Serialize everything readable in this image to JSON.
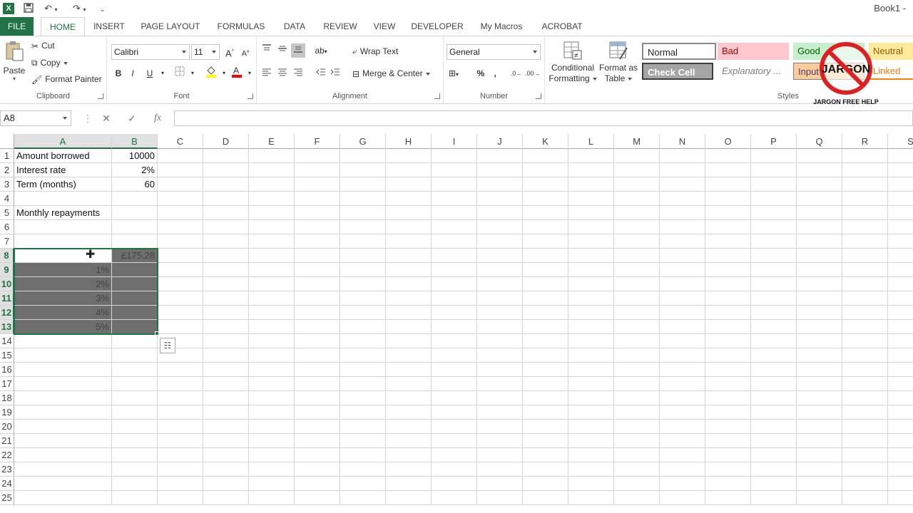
{
  "window": {
    "title": "Book1 -"
  },
  "tabs": [
    "FILE",
    "HOME",
    "INSERT",
    "PAGE LAYOUT",
    "FORMULAS",
    "DATA",
    "REVIEW",
    "VIEW",
    "DEVELOPER",
    "My Macros",
    "ACROBAT"
  ],
  "clipboard": {
    "paste": "Paste",
    "cut": "Cut",
    "copy": "Copy",
    "format_painter": "Format Painter",
    "label": "Clipboard"
  },
  "font": {
    "name": "Calibri",
    "size": "11",
    "label": "Font",
    "bold": "B",
    "italic": "I",
    "underline": "U",
    "grow": "A",
    "shrink": "A"
  },
  "alignment": {
    "wrap_text": "Wrap Text",
    "merge_center": "Merge & Center",
    "label": "Alignment"
  },
  "number": {
    "format": "General",
    "label": "Number",
    "percent": "%",
    "comma": ","
  },
  "styles": {
    "conditional_formatting": [
      "Conditional",
      "Formatting"
    ],
    "format_as_table": [
      "Format as",
      "Table"
    ],
    "label": "Styles",
    "cells": [
      {
        "name": "Normal",
        "bg": "#ffffff",
        "fg": "#000000"
      },
      {
        "name": "Bad",
        "bg": "#ffc7ce",
        "fg": "#9c0006"
      },
      {
        "name": "Good",
        "bg": "#c6efce",
        "fg": "#006100"
      },
      {
        "name": "Neutral",
        "bg": "#ffeb9c",
        "fg": "#9c5700"
      },
      {
        "name": "Check Cell",
        "bg": "#a5a5a5",
        "fg": "#ffffff"
      },
      {
        "name": "Explanatory ...",
        "bg": "#ffffff",
        "fg": "#7f7f7f"
      },
      {
        "name": "Input",
        "bg": "#ffcc99",
        "fg": "#3f3f76"
      },
      {
        "name": "Linked Ce",
        "bg": "#ffffff",
        "fg": "#fa7d00"
      }
    ]
  },
  "logo": {
    "text": "JARGON",
    "caption": "JARGON FREE HELP"
  },
  "formula_bar": {
    "name_box": "A8",
    "cancel": "✕",
    "enter": "✓",
    "fx": "fx",
    "content": ""
  },
  "columns": [
    "A",
    "B",
    "C",
    "D",
    "E",
    "F",
    "G",
    "H",
    "I",
    "J",
    "K",
    "L",
    "M",
    "N",
    "O",
    "P",
    "Q",
    "R",
    "S"
  ],
  "rows": [
    "1",
    "2",
    "3",
    "4",
    "5",
    "6",
    "7",
    "8",
    "9",
    "10",
    "11",
    "12",
    "13",
    "14",
    "15",
    "16",
    "17",
    "18",
    "19",
    "20",
    "21",
    "22",
    "23",
    "24",
    "25"
  ],
  "cells": {
    "A1": "Amount borrowed",
    "B1": "10000",
    "A2": "Interest rate",
    "B2": "2%",
    "A3": "Term (months)",
    "B3": "60",
    "A5": "Monthly repayments",
    "B8": "£175.28",
    "A9": "1%",
    "A10": "2%",
    "A11": "3%",
    "A12": "4%",
    "A13": "5%"
  },
  "colors": {
    "accent": "#217346",
    "selection": "#6e6e6e"
  }
}
